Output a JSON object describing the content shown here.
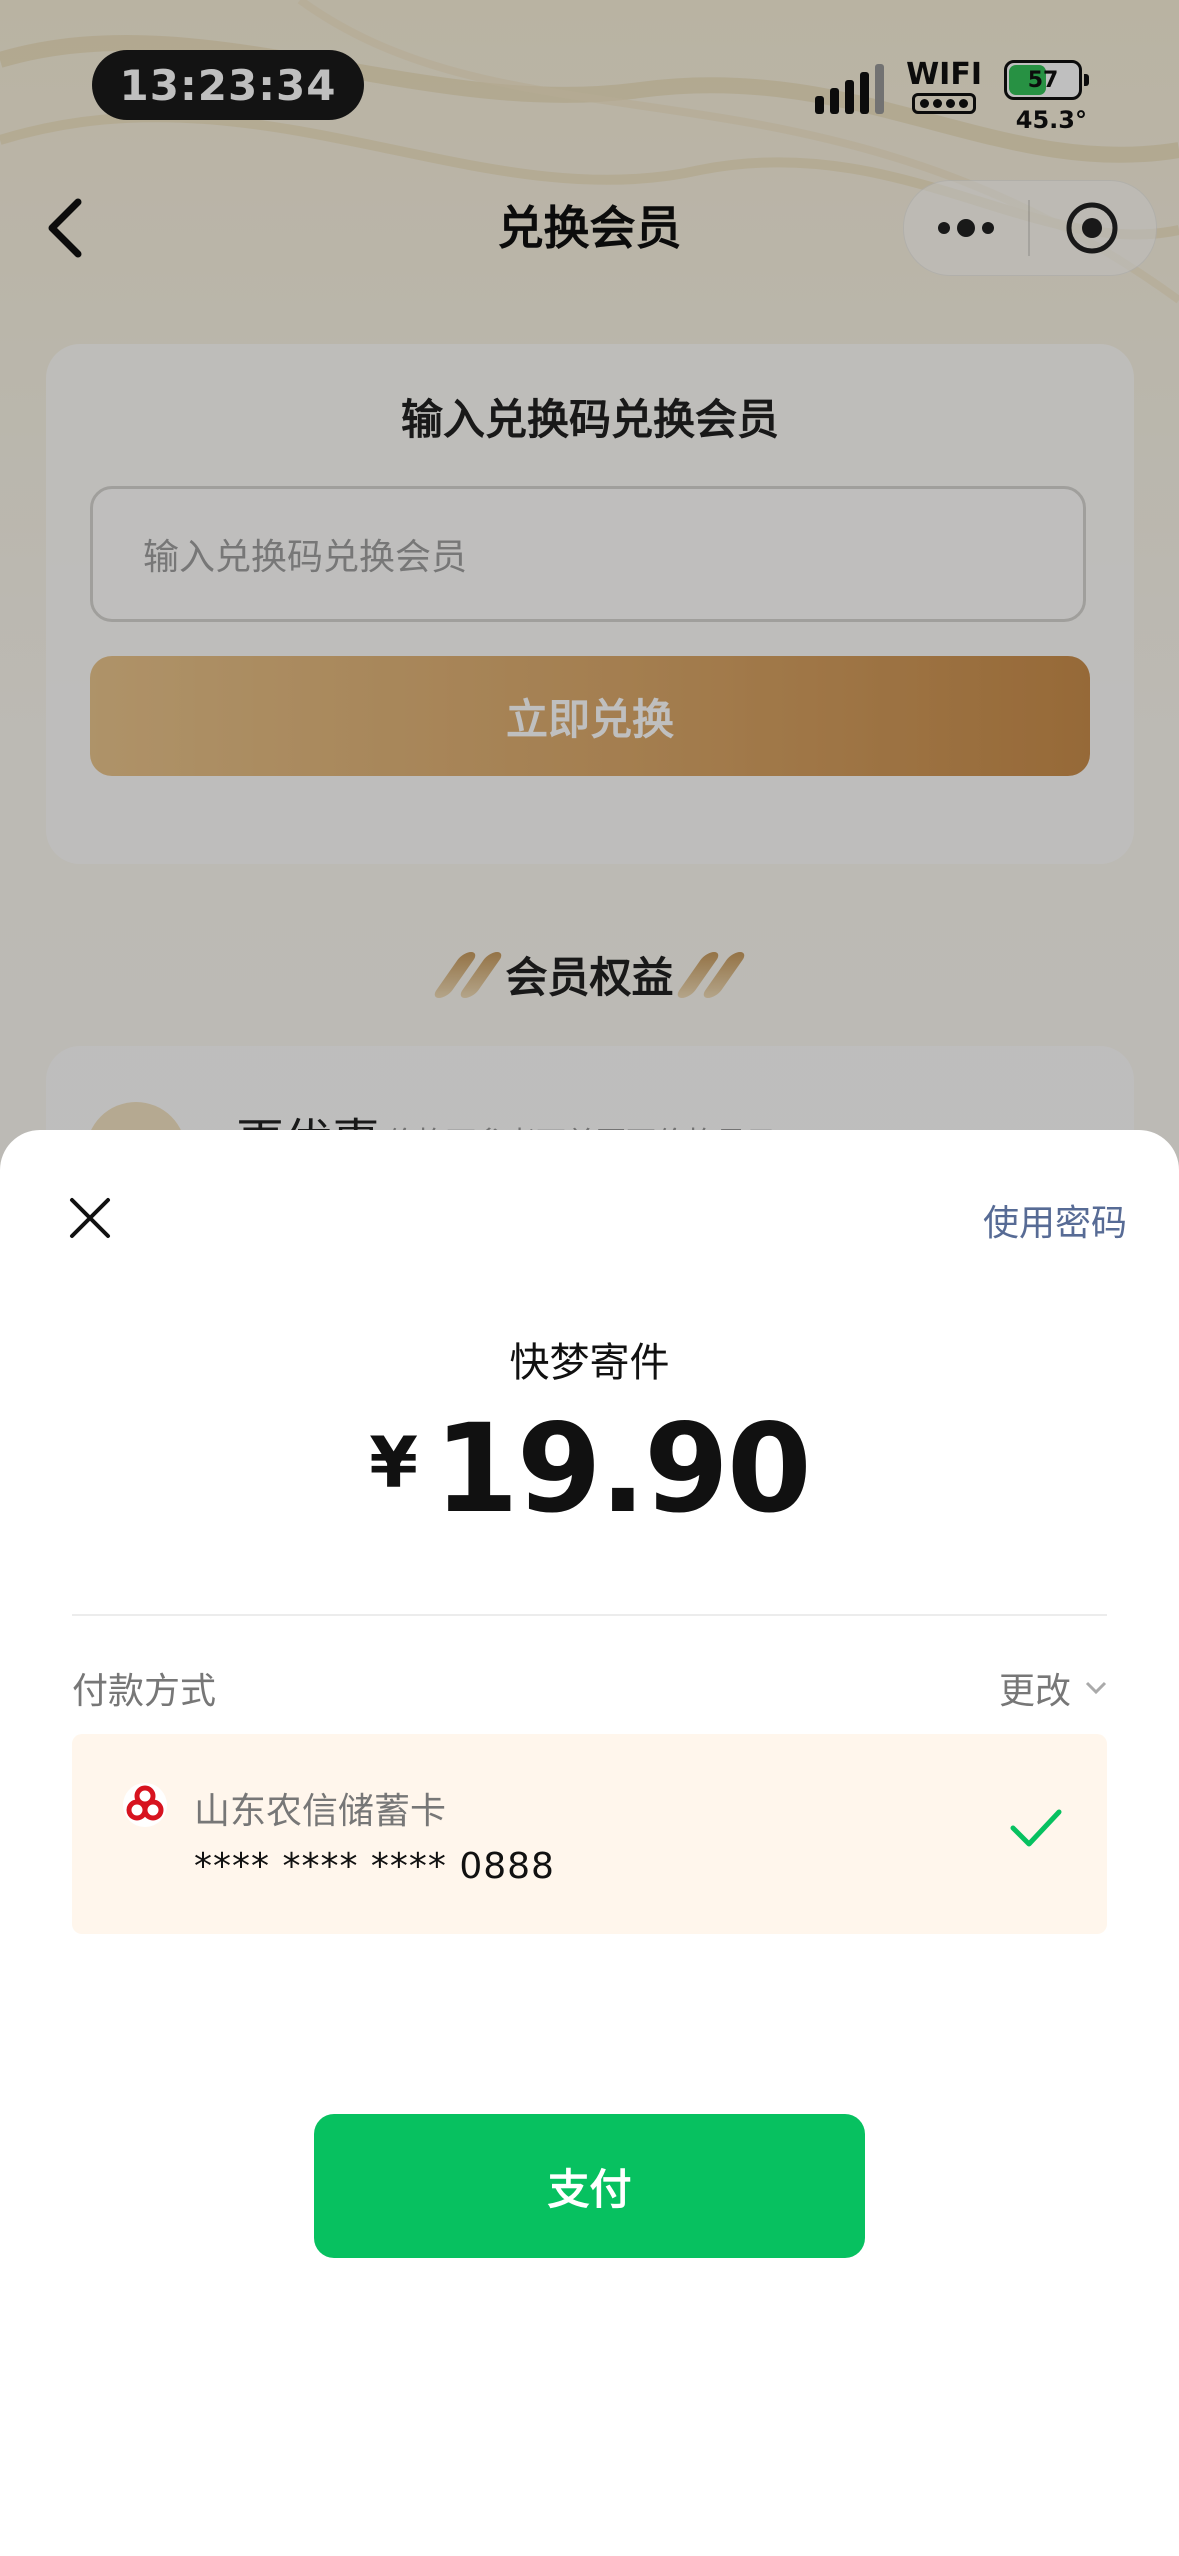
{
  "status_bar": {
    "time": "13:23:34",
    "wifi_label": "WIFI",
    "battery_level": "57",
    "battery_percent": 57,
    "temperature": "45.3°"
  },
  "nav": {
    "title": "兑换会员",
    "back_icon": "chevron-left-icon",
    "more_icon": "more-dots-icon",
    "close_icon": "target-close-icon"
  },
  "redeem": {
    "title": "输入兑换码兑换会员",
    "input_placeholder": "输入兑换码兑换会员",
    "button_label": "立即兑换"
  },
  "benefits": {
    "title": "会员权益",
    "item_name": "更优惠",
    "item_desc": "价格可参考下单页面价格显示"
  },
  "payment_sheet": {
    "use_password_label": "使用密码",
    "merchant": "快梦寄件",
    "currency_symbol": "¥",
    "amount": "19.90",
    "payment_method_label": "付款方式",
    "change_label": "更改",
    "card": {
      "bank_name": "山东农信储蓄卡",
      "card_number": "**** **** **** 0888",
      "selected": true
    },
    "pay_button_label": "支付"
  },
  "colors": {
    "pay_green": "#07c160",
    "link_blue": "#576b95",
    "gold": "#d9a566",
    "card_bg": "#fff6ec"
  }
}
